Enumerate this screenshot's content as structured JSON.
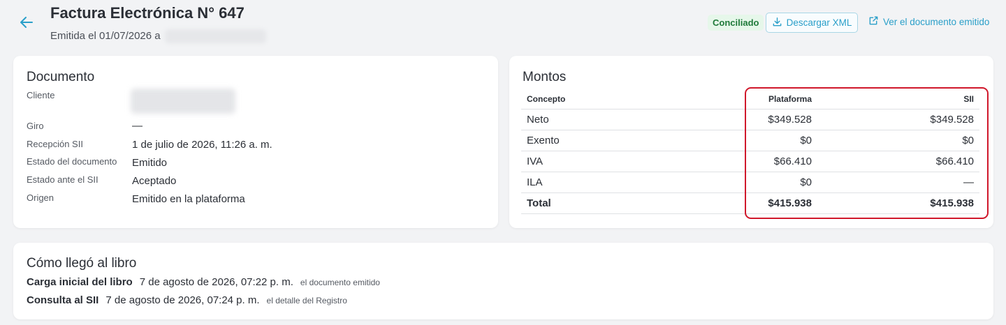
{
  "header": {
    "title": "Factura Electrónica N° 647",
    "subtitle": "Emitida el 01/07/2026 a",
    "badge": "Conciliado",
    "download_label": "Descargar XML",
    "view_label": "Ver el documento emitido"
  },
  "documento": {
    "title": "Documento",
    "fields": [
      {
        "label": "Cliente",
        "value": ""
      },
      {
        "label": "Giro",
        "value": "—"
      },
      {
        "label": "Recepción SII",
        "value": "1 de julio de 2026, 11:26 a. m."
      },
      {
        "label": "Estado del documento",
        "value": "Emitido"
      },
      {
        "label": "Estado ante el SII",
        "value": "Aceptado"
      },
      {
        "label": "Origen",
        "value": "Emitido en la plataforma"
      }
    ]
  },
  "montos": {
    "title": "Montos",
    "columns": [
      "Concepto",
      "Plataforma",
      "SII"
    ],
    "rows": [
      {
        "concepto": "Neto",
        "plataforma": "$349.528",
        "sii": "$349.528"
      },
      {
        "concepto": "Exento",
        "plataforma": "$0",
        "sii": "$0"
      },
      {
        "concepto": "IVA",
        "plataforma": "$66.410",
        "sii": "$66.410"
      },
      {
        "concepto": "ILA",
        "plataforma": "$0",
        "sii": "—"
      },
      {
        "concepto": "Total",
        "plataforma": "$415.938",
        "sii": "$415.938"
      }
    ]
  },
  "libro": {
    "title": "Cómo llegó al libro",
    "events": [
      {
        "name": "Carga inicial del libro",
        "date": "7 de agosto de 2026, 07:22 p. m.",
        "note": "el documento emitido"
      },
      {
        "name": "Consulta al SII",
        "date": "7 de agosto de 2026, 07:24 p. m.",
        "note": "el detalle del Registro"
      }
    ]
  },
  "colors": {
    "accent": "#2a9fc9",
    "badge_bg": "#e6f7ea",
    "badge_text": "#1f7a3a",
    "highlight": "#d0182b"
  }
}
